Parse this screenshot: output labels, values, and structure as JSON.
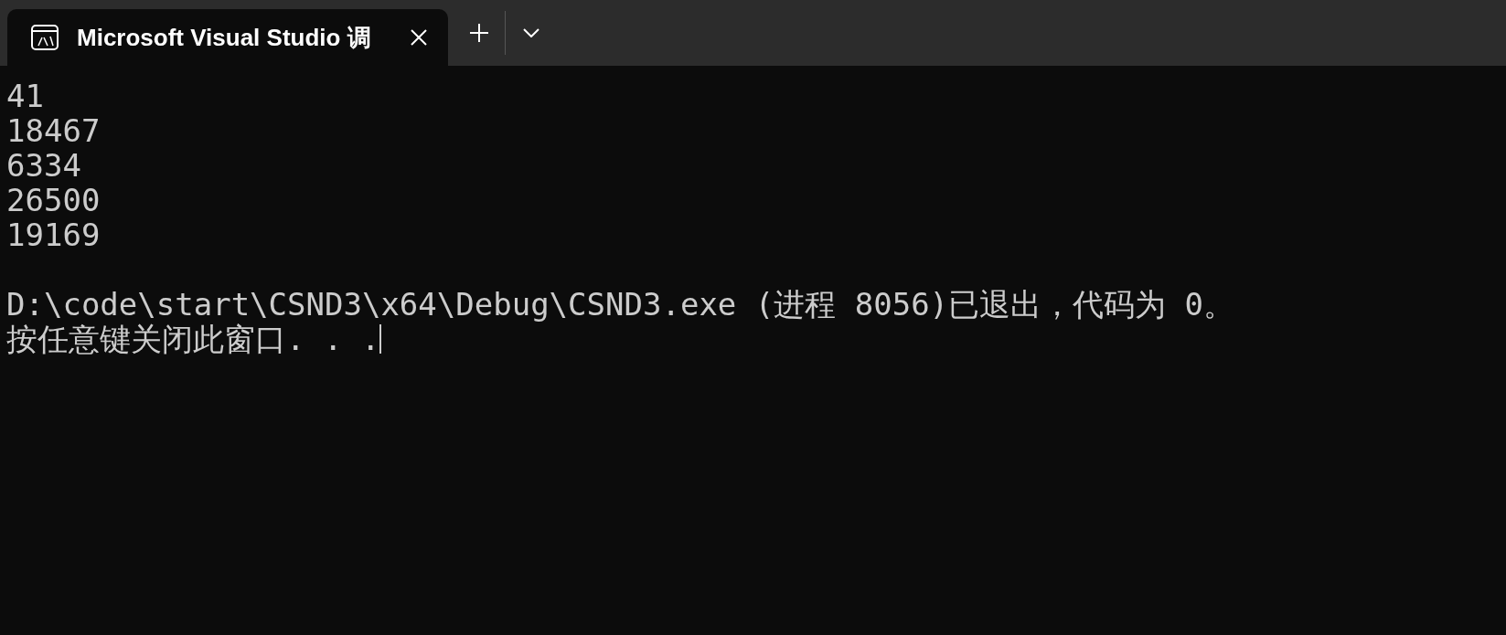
{
  "tabs": [
    {
      "label": "Microsoft Visual Studio 调",
      "selected": true
    }
  ],
  "console": {
    "output_lines": [
      "41",
      "18467",
      "6334",
      "26500",
      "19169"
    ],
    "exit_lines": [
      "D:\\code\\start\\CSND3\\x64\\Debug\\CSND3.exe (进程 8056)已退出，代码为 0。",
      "按任意键关闭此窗口. . ."
    ]
  }
}
